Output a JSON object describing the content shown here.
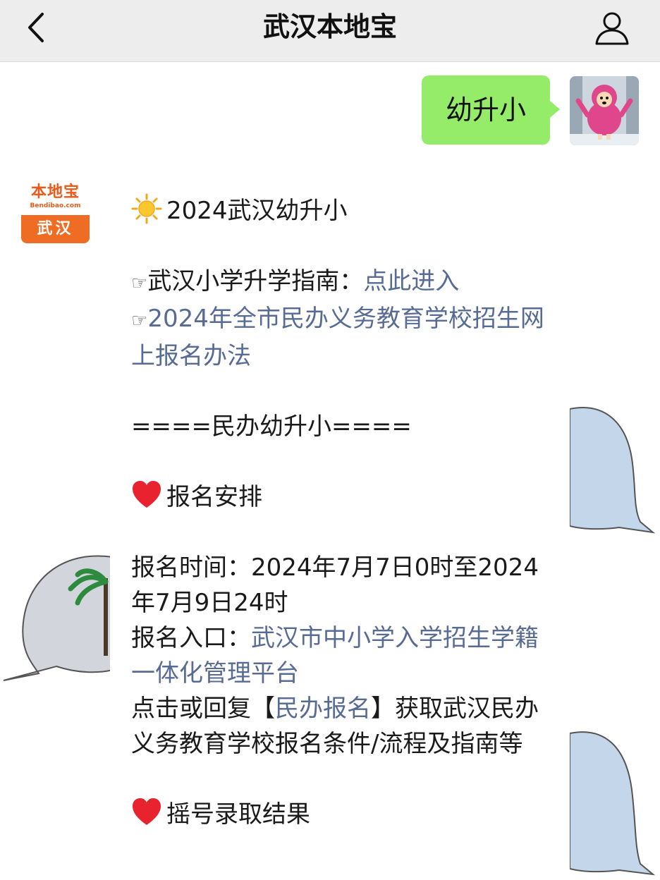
{
  "navbar": {
    "title": "武汉本地宝",
    "back_icon": "chevron-left-icon",
    "profile_icon": "person-icon"
  },
  "user_message": {
    "text": "幼升小"
  },
  "account": {
    "logo_text": "本地宝",
    "logo_url": "Bendibao.com",
    "city": "武汉",
    "brand_color": "#ef6c25"
  },
  "message": {
    "title": "2024武汉幼升小",
    "guide_prefix": "武汉小学升学指南：",
    "guide_link": "点此进入",
    "policy_link": "2024年全市民办义务教育学校招生网上报名办法",
    "section_header": "====民办幼升小====",
    "signup_heading": "报名安排",
    "signup_time_label": "报名时间：",
    "signup_time_value": "2024年7月7日0时至2024年7月9日24时",
    "entry_label": "报名入口：",
    "entry_link": "武汉市中小学入学招生学籍一体化管理平台",
    "reply_prefix": "点击或回复【",
    "reply_keyword": "民办报名",
    "reply_suffix": "】获取武汉民办义务教育学校报名条件/流程及指南等",
    "lottery_heading": "摇号录取结果"
  },
  "colors": {
    "link": "#576b95",
    "outgoing_bubble": "#95ec69",
    "navbar_bg": "#ededed"
  }
}
